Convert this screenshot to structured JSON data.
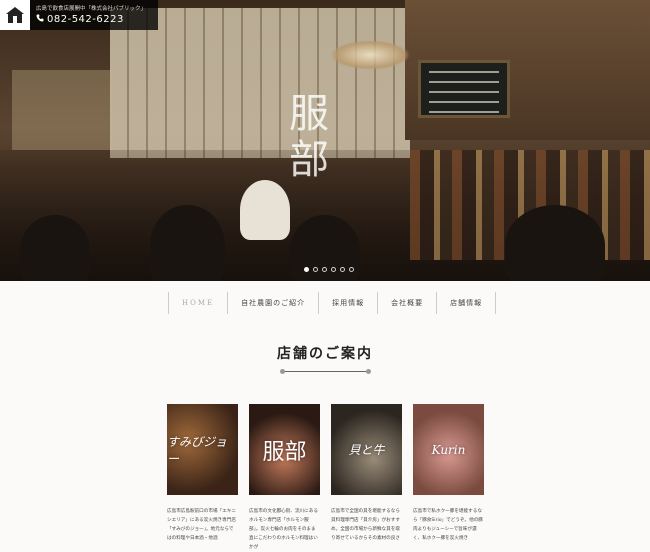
{
  "header": {
    "company": "広島で飲食店展開中「株式会社パブリック」",
    "tel": "082-542-6223",
    "logo_name": "house-logo"
  },
  "hero": {
    "kanji": "服部",
    "slides": 6,
    "active_slide": 1
  },
  "nav": {
    "items": [
      "HOME",
      "自社農園のご紹介",
      "採用情報",
      "会社概要",
      "店舗情報"
    ]
  },
  "section": {
    "title": "店舗のご案内"
  },
  "shops": [
    {
      "label": "すみびジョー",
      "desc": "広島市広島駅前口の市場「エキニシエリア」にある炭火焼き専門店「すみびのジョー」。地元ならではの料理や日本酒・地酒"
    },
    {
      "label": "服部",
      "desc": "広島市の文化都心街、流川にあるホルモン専門店「ホルモン服部」。炭火七輪のお肉をそのまま直にこだわりのホルモン料理はいかが"
    },
    {
      "label": "貝と牛",
      "desc": "広島市で全国の貝を堪能するなら貝料理専門店「貝介房」がおすすめ。全国の市場から新鮮な貝を取り寄せているからその素材の良さ"
    },
    {
      "label": "Kurin",
      "desc": "広島市で私ホクー豚を堪能するなら「豚食Sirio」でどうぞ。他の豚肉よりもジューシーで旨味が濃く、私ホク一豚を炭火焼き"
    }
  ],
  "colors": {
    "accent": "#222222",
    "nav_border": "#cccccc"
  }
}
